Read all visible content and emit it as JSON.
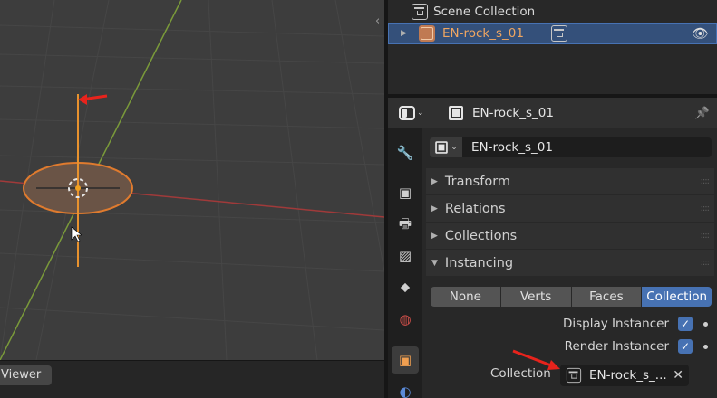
{
  "viewport": {
    "collapse_glyph": "‹",
    "bottom_tab_label": "Viewer"
  },
  "outliner": {
    "scene_collection_label": "Scene Collection",
    "selected_object_label": "EN-rock_s_01",
    "expand_glyph": "▶",
    "eye_glyph": "👁"
  },
  "properties": {
    "header_object_name": "EN-rock_s_01",
    "pin_glyph": "📌",
    "object_name_value": "EN-rock_s_01",
    "panels": {
      "transform": "Transform",
      "relations": "Relations",
      "collections": "Collections",
      "instancing": "Instancing"
    },
    "collapsed_glyph": "▶",
    "expanded_glyph": "▼",
    "instancing_modes": [
      "None",
      "Verts",
      "Faces",
      "Collection"
    ],
    "selected_instancing_mode": "Collection",
    "display_instancer_label": "Display Instancer",
    "display_instancer_checked": true,
    "render_instancer_label": "Render Instancer",
    "render_instancer_checked": true,
    "collection_label": "Collection",
    "collection_value": "EN-rock_s_...",
    "clear_glyph": "✕",
    "check_glyph": "✓"
  },
  "colors": {
    "selection_blue": "#4772b3",
    "active_orange": "#f0a661",
    "annotation_red": "#e8231c"
  }
}
